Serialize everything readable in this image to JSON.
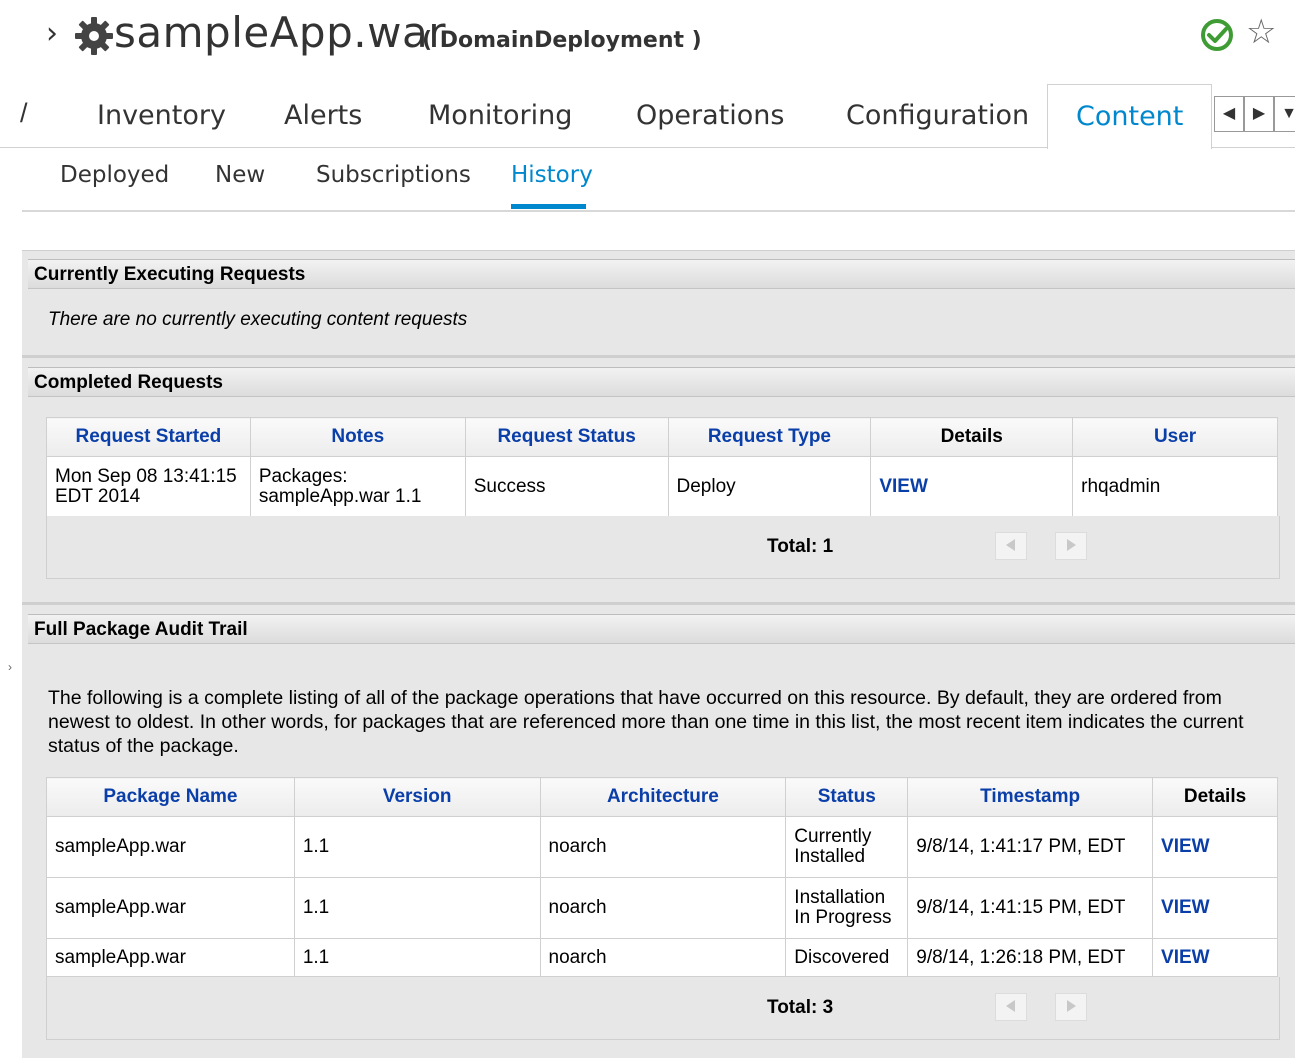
{
  "header": {
    "title": "sampleApp.war",
    "subtitle": "( DomainDeployment )"
  },
  "tabs": [
    {
      "label": "Inventory"
    },
    {
      "label": "Alerts"
    },
    {
      "label": "Monitoring"
    },
    {
      "label": "Operations"
    },
    {
      "label": "Configuration"
    },
    {
      "label": "Content",
      "active": true
    }
  ],
  "subtabs": [
    {
      "label": "Deployed"
    },
    {
      "label": "New"
    },
    {
      "label": "Subscriptions"
    },
    {
      "label": "History",
      "active": true
    }
  ],
  "executing": {
    "title": "Currently Executing Requests",
    "message": "There are no currently executing content requests"
  },
  "completed": {
    "title": "Completed Requests",
    "columns": [
      "Request Started",
      "Notes",
      "Request Status",
      "Request Type",
      "Details",
      "User"
    ],
    "rows": [
      {
        "started": "Mon Sep 08 13:41:15 EDT 2014",
        "notes": "Packages: sampleApp.war 1.1",
        "status": "Success",
        "type": "Deploy",
        "details": "VIEW",
        "user": "rhqadmin"
      }
    ],
    "total": "Total: 1"
  },
  "audit": {
    "title": "Full Package Audit Trail",
    "description": "The following is a complete listing of all of the package operations that have occurred on this resource. By default, they are ordered from newest to oldest. In other words, for packages that are referenced more than one time in this list, the most recent item indicates the current status of the package.",
    "columns": [
      "Package Name",
      "Version",
      "Architecture",
      "Status",
      "Timestamp",
      "Details"
    ],
    "rows": [
      {
        "name": "sampleApp.war",
        "version": "1.1",
        "arch": "noarch",
        "status": "Currently Installed",
        "timestamp": "9/8/14, 1:41:17 PM, EDT",
        "details": "VIEW"
      },
      {
        "name": "sampleApp.war",
        "version": "1.1",
        "arch": "noarch",
        "status": "Installation In Progress",
        "timestamp": "9/8/14, 1:41:15 PM, EDT",
        "details": "VIEW"
      },
      {
        "name": "sampleApp.war",
        "version": "1.1",
        "arch": "noarch",
        "status": "Discovered",
        "timestamp": "9/8/14, 1:26:18 PM, EDT",
        "details": "VIEW"
      }
    ],
    "total": "Total: 3"
  },
  "colors": {
    "accent": "#0088ce",
    "link": "#0a3ea8",
    "ok": "#3f9c35"
  }
}
